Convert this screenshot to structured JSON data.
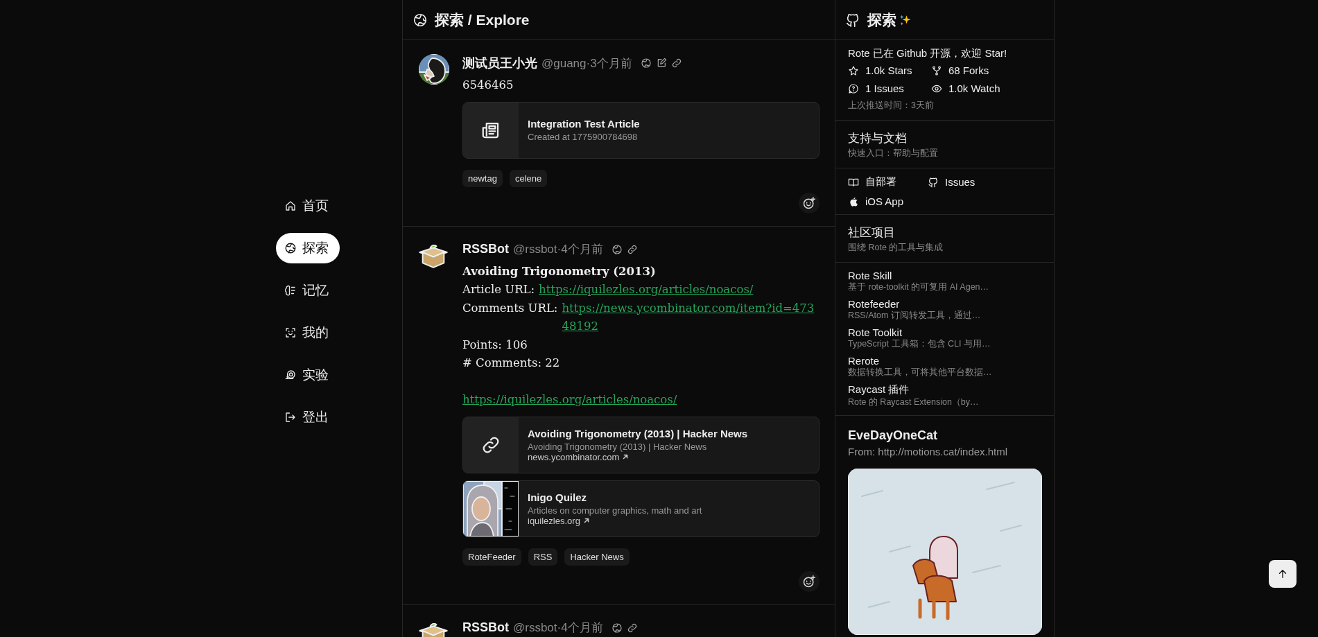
{
  "nav": [
    {
      "label": "首页",
      "selected": false
    },
    {
      "label": "探索",
      "selected": true
    },
    {
      "label": "记忆",
      "selected": false
    },
    {
      "label": "我的",
      "selected": false
    },
    {
      "label": "实验",
      "selected": false
    },
    {
      "label": "登出",
      "selected": false
    }
  ],
  "feed": {
    "title": "探索 / Explore"
  },
  "posts": [
    {
      "author": "测试员王小光",
      "meta": "@guang·3个月前",
      "editable": true,
      "body": [
        {
          "kind": "text",
          "text": "6546465"
        }
      ],
      "cards": [
        {
          "kind": "article",
          "title": "Integration Test Article",
          "subtitle": "Created at 1775900784698"
        }
      ],
      "tags": [
        "newtag",
        "celene"
      ]
    },
    {
      "author": "RSSBot",
      "meta": "@rssbot·4个月前",
      "editable": false,
      "body": [
        {
          "kind": "title",
          "text": "Avoiding Trigonometry (2013)"
        },
        {
          "kind": "labeled_link",
          "label": "Article URL:",
          "url": "https://iquilezles.org/articles/noacos/"
        },
        {
          "kind": "labeled_link",
          "label": "Comments URL:",
          "url": "https://news.ycombinator.com/item?id=47348192"
        },
        {
          "kind": "text",
          "text": "Points: 106"
        },
        {
          "kind": "text",
          "text": "# Comments: 22"
        },
        {
          "kind": "spacer"
        },
        {
          "kind": "link",
          "url": "https://iquilezles.org/articles/noacos/"
        }
      ],
      "cards": [
        {
          "kind": "link",
          "title": "Avoiding Trigonometry (2013) | Hacker News",
          "subtitle": "Avoiding Trigonometry (2013) | Hacker News",
          "domain": "news.ycombinator.com"
        },
        {
          "kind": "picture",
          "title": "Inigo Quilez",
          "subtitle": "Articles on computer graphics, math and art",
          "domain": "iquilezles.org"
        }
      ],
      "tags": [
        "RoteFeeder",
        "RSS",
        "Hacker News"
      ]
    },
    {
      "author": "RSSBot",
      "meta": "@rssbot·4个月前",
      "editable": false
    }
  ],
  "sidebar": {
    "title": "探索",
    "repo": {
      "intro": "Rote 已在 Github 开源，欢迎 Star!",
      "stats": [
        "1.0k Stars",
        "68 Forks",
        "1 Issues",
        "1.0k Watch"
      ],
      "pushed": "上次推送时间：3天前"
    },
    "docs": {
      "title": "支持与文档",
      "subtitle": "快速入口：帮助与配置",
      "links": [
        "自部署",
        "Issues",
        "iOS App"
      ]
    },
    "community": {
      "title": "社区项目",
      "subtitle": "围绕 Rote 的工具与集成",
      "items": [
        {
          "name": "Rote Skill",
          "desc": "基于 rote-toolkit 的可复用 AI Agen…"
        },
        {
          "name": "Rotefeeder",
          "desc": "RSS/Atom 订阅转发工具，通过…"
        },
        {
          "name": "Rote Toolkit",
          "desc": "TypeScript 工具箱：包含 CLI 与用…"
        },
        {
          "name": "Rerote",
          "desc": "数据转换工具，可将其他平台数据…"
        },
        {
          "name": "Raycast 插件",
          "desc": "Rote 的 Raycast Extension（by…"
        }
      ]
    },
    "cat": {
      "title": "EveDayOneCat",
      "source": "From: http://motions.cat/index.html"
    }
  }
}
